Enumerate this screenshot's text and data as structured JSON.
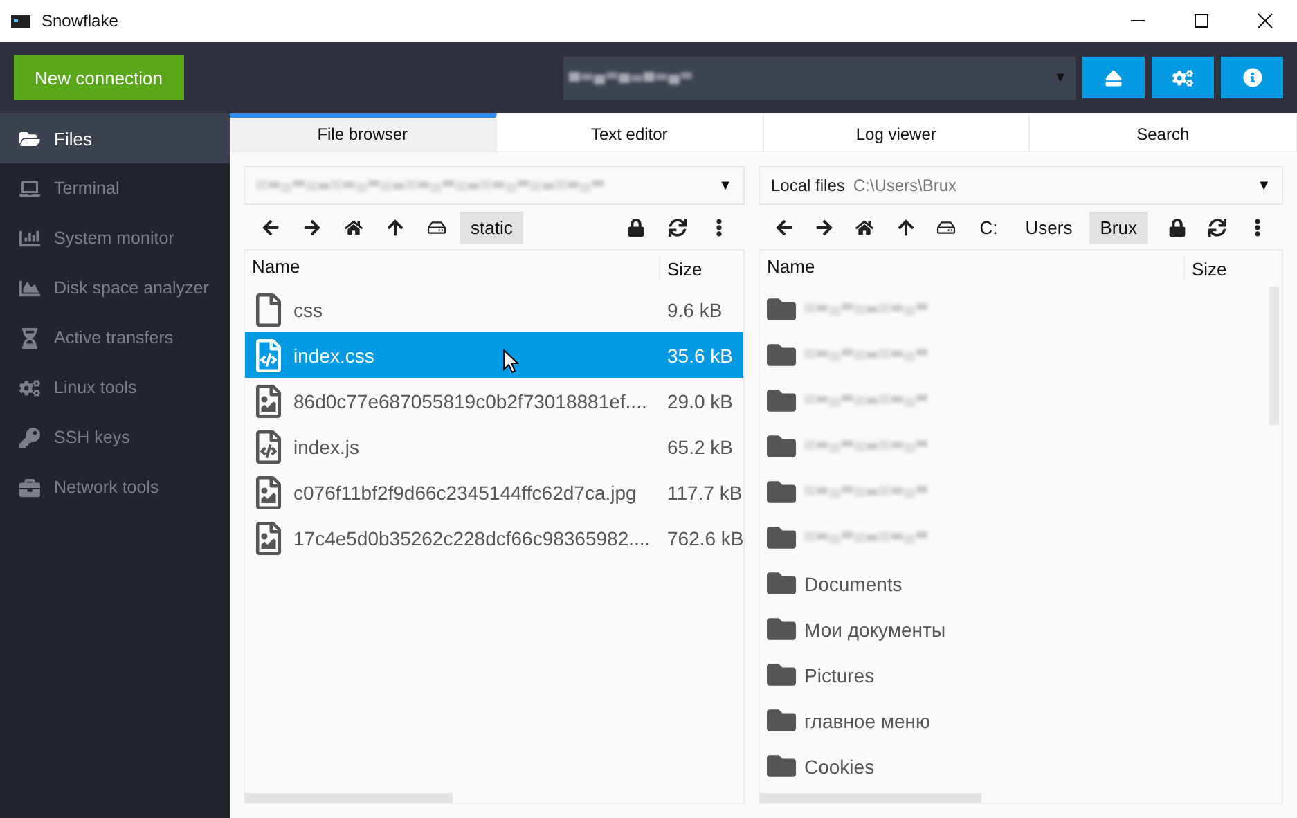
{
  "window": {
    "title": "Snowflake"
  },
  "toolbar": {
    "new_connection": "New connection",
    "connection_caret": "▼"
  },
  "sidebar": {
    "items": [
      {
        "label": "Files",
        "selected": true
      },
      {
        "label": "Terminal",
        "selected": false
      },
      {
        "label": "System monitor",
        "selected": false
      },
      {
        "label": "Disk space analyzer",
        "selected": false
      },
      {
        "label": "Active transfers",
        "selected": false
      },
      {
        "label": "Linux tools",
        "selected": false
      },
      {
        "label": "SSH keys",
        "selected": false
      },
      {
        "label": "Network tools",
        "selected": false
      }
    ]
  },
  "tabs": [
    {
      "label": "File browser",
      "selected": true
    },
    {
      "label": "Text editor",
      "selected": false
    },
    {
      "label": "Log viewer",
      "selected": false
    },
    {
      "label": "Search",
      "selected": false
    }
  ],
  "panes": [
    {
      "location": {
        "caret": "▼"
      },
      "breadcrumbs": [
        {
          "label": "static",
          "selected": true
        }
      ],
      "columns": [
        "Name",
        "Size"
      ],
      "rows": [
        {
          "kind": "file",
          "name": "css",
          "size": "9.6 kB",
          "selected": false
        },
        {
          "kind": "code",
          "name": "index.css",
          "size": "35.6 kB",
          "selected": true
        },
        {
          "kind": "image",
          "name": "86d0c77e687055819c0b2f73018881ef....",
          "size": "29.0 kB",
          "selected": false
        },
        {
          "kind": "code",
          "name": "index.js",
          "size": "65.2 kB",
          "selected": false
        },
        {
          "kind": "image",
          "name": "c076f11bf2f9d66c2345144ffc62d7ca.jpg",
          "size": "117.7 kB",
          "selected": false
        },
        {
          "kind": "image",
          "name": "17c4e5d0b35262c228dcf66c98365982....",
          "size": "762.6 kB",
          "selected": false
        }
      ]
    },
    {
      "location": {
        "label": "Local files",
        "path": "C:\\Users\\Brux",
        "caret": "▼"
      },
      "breadcrumbs": [
        {
          "label": "C:",
          "selected": false
        },
        {
          "label": "Users",
          "selected": false
        },
        {
          "label": "Brux",
          "selected": true
        }
      ],
      "columns": [
        "Name",
        "Size"
      ],
      "rows": [
        {
          "kind": "folder",
          "selected": false
        },
        {
          "kind": "folder",
          "selected": false
        },
        {
          "kind": "folder",
          "selected": false
        },
        {
          "kind": "folder",
          "selected": false
        },
        {
          "kind": "folder",
          "selected": false
        },
        {
          "kind": "folder",
          "selected": false
        },
        {
          "kind": "folder",
          "name": "Documents",
          "selected": false
        },
        {
          "kind": "folder",
          "name": "Мои документы",
          "selected": false
        },
        {
          "kind": "folder",
          "name": "Pictures",
          "selected": false
        },
        {
          "kind": "folder",
          "name": "главное меню",
          "selected": false
        },
        {
          "kind": "folder",
          "name": "Cookies",
          "selected": false
        }
      ]
    }
  ]
}
